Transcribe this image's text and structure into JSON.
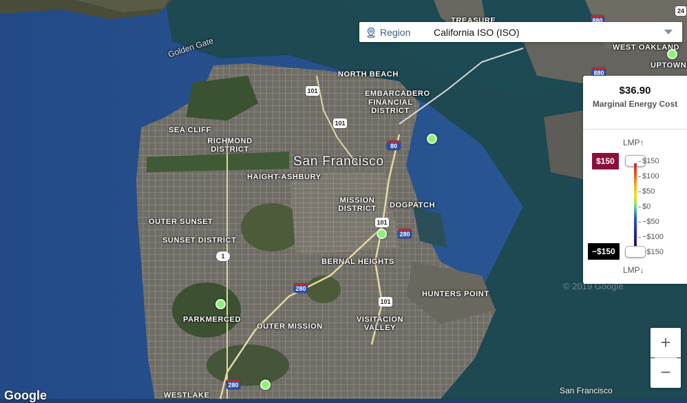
{
  "region": {
    "label": "Region",
    "value": "California ISO (ISO)"
  },
  "legend": {
    "price": "$36.90",
    "description": "Marginal Energy Cost",
    "lmp_up": "LMP↑",
    "lmp_down": "LMP↓",
    "max_value": "$150",
    "min_value": "−$150",
    "max_color": "#8b0f3c",
    "min_color": "#000000",
    "ticks": [
      "$150",
      "$100",
      "$50",
      "$0",
      "−$50",
      "−$100",
      "−$150"
    ]
  },
  "map": {
    "labels": {
      "golden_gate": "Golden Gate",
      "treasure": "TREASURE",
      "north_beach": "NORTH BEACH",
      "embarcadero": "EMBARCADERO",
      "financial_district": "FINANCIAL DISTRICT",
      "sea_cliff": "SEA CLIFF",
      "richmond_district": "RICHMOND DISTRICT",
      "san_francisco": "San Francisco",
      "haight_ashbury": "HAIGHT-ASHBURY",
      "mission_district": "MISSION DISTRICT",
      "dogpatch": "DOGPATCH",
      "outer_sunset": "OUTER SUNSET",
      "sunset_district": "SUNSET DISTRICT",
      "bernal_heights": "BERNAL HEIGHTS",
      "hunters_point": "HUNTERS POINT",
      "parkmerced": "PARKMERCED",
      "outer_mission": "OUTER MISSION",
      "visitacion_valley": "VISITACION VALLEY",
      "west_oakland": "WEST OAKLAND",
      "uptown": "UPTOWN",
      "westlake": "WESTLAKE"
    },
    "shields": [
      "101",
      "101",
      "80",
      "101",
      "280",
      "1",
      "280",
      "101",
      "280",
      "880",
      "880",
      "24"
    ],
    "node_color": "#8ef07a",
    "scale_label": "San Francisco",
    "google": "Google",
    "copyright": "© 2019 Google"
  },
  "zoom": {
    "in": "+",
    "out": "−"
  }
}
